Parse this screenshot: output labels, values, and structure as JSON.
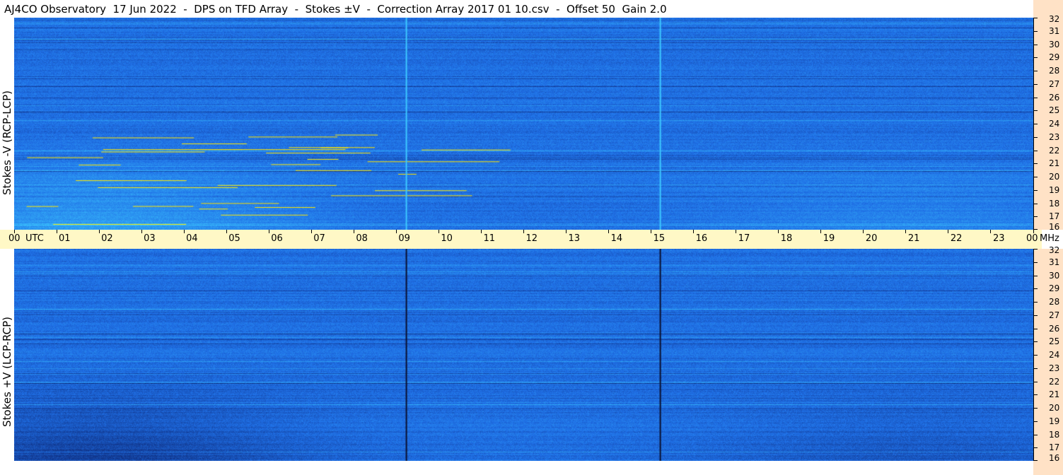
{
  "title": "AJ4CO Observatory  17 Jun 2022  -  DPS on TFD Array  -  Stokes ±V  -  Correction Array 2017 01 10.csv  -  Offset 50  Gain 2.0",
  "chart_data": [
    {
      "type": "heatmap",
      "panel": "top",
      "ylabel": "Stokes -V (RCP-LCP)",
      "x_unit": "UTC",
      "y_unit": "MHz",
      "x_range": [
        0,
        24
      ],
      "y_range": [
        16,
        32
      ],
      "x_ticks": [
        "00",
        "01",
        "02",
        "03",
        "04",
        "05",
        "06",
        "07",
        "08",
        "09",
        "10",
        "11",
        "12",
        "13",
        "14",
        "15",
        "16",
        "17",
        "18",
        "19",
        "20",
        "21",
        "22",
        "23",
        "00"
      ],
      "y_ticks": [
        "16",
        "17",
        "18",
        "19",
        "20",
        "21",
        "22",
        "23",
        "24",
        "25",
        "26",
        "27",
        "28",
        "29",
        "30",
        "31",
        "32"
      ],
      "colors": {
        "base": "#1f6fe6",
        "light": "#3cc8ff",
        "hot": "#ffe600",
        "dark": "#0a1a60"
      },
      "vertical_lines_utc": [
        9.22,
        15.2
      ],
      "vertical_line_color": "#3cc8ff"
    },
    {
      "type": "heatmap",
      "panel": "bottom",
      "ylabel": "Stokes +V (LCP-RCP)",
      "x_unit": "UTC",
      "y_unit": "MHz",
      "x_range": [
        0,
        24
      ],
      "y_range": [
        16,
        32
      ],
      "y_ticks": [
        "16",
        "17",
        "18",
        "19",
        "20",
        "21",
        "22",
        "23",
        "24",
        "25",
        "26",
        "27",
        "28",
        "29",
        "30",
        "31",
        "32"
      ],
      "colors": {
        "base": "#1f6fe6",
        "light": "#3cc8ff",
        "dark": "#0a1a60"
      },
      "vertical_lines_utc": [
        9.22,
        15.2
      ],
      "vertical_line_color": "#0a1030"
    }
  ],
  "axis": {
    "utc_label": "UTC",
    "mhz_label": "MHz"
  }
}
